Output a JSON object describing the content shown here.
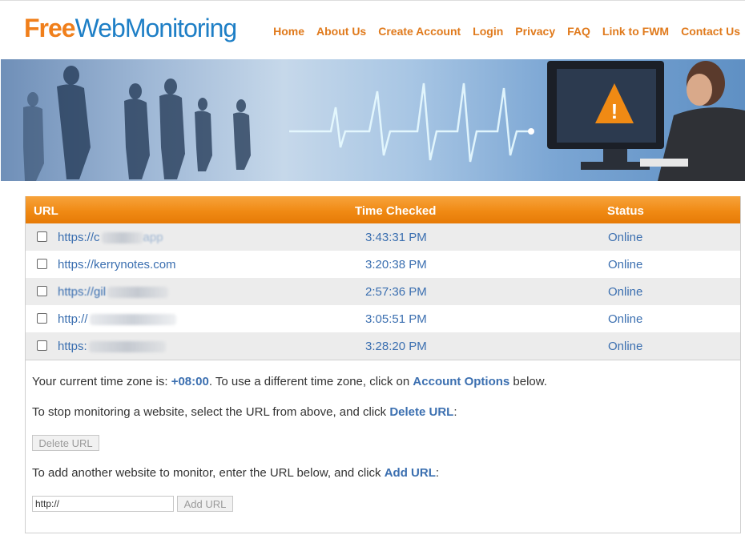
{
  "logo": {
    "part1": "Free",
    "part2": "WebMonitoring"
  },
  "nav": [
    "Home",
    "About Us",
    "Create Account",
    "Login",
    "Privacy",
    "FAQ",
    "Link to FWM",
    "Contact Us"
  ],
  "table": {
    "headers": {
      "url": "URL",
      "time": "Time Checked",
      "status": "Status"
    },
    "rows": [
      {
        "url_prefix": "https://c",
        "url_suffix": "app",
        "time": "3:43:31 PM",
        "status": "Online"
      },
      {
        "url_prefix": "https://kerrynotes.com",
        "url_suffix": "",
        "time": "3:20:38 PM",
        "status": "Online"
      },
      {
        "url_prefix": "https://gil",
        "url_suffix": "",
        "time": "2:57:36 PM",
        "status": "Online"
      },
      {
        "url_prefix": "http://",
        "url_suffix": "",
        "time": "3:05:51 PM",
        "status": "Online"
      },
      {
        "url_prefix": "https:",
        "url_suffix": "",
        "time": "3:28:20 PM",
        "status": "Online"
      }
    ]
  },
  "timezone": {
    "prefix": "Your current time zone is: ",
    "value": "+08:00",
    "middle": ". To use a different time zone, click on ",
    "link": "Account Options",
    "suffix": " below."
  },
  "delete": {
    "prefix": "To stop monitoring a website, select the URL from above, and click ",
    "link": "Delete URL",
    "suffix": ":",
    "button": "Delete URL"
  },
  "add": {
    "prefix": "To add another website to monitor, enter the URL below, and click ",
    "link": "Add URL",
    "suffix": ":",
    "input_value": "http://",
    "button": "Add URL"
  },
  "colors": {
    "accent": "#f08a14",
    "brand_blue": "#1e7fc6",
    "link": "#3b6fb0"
  }
}
